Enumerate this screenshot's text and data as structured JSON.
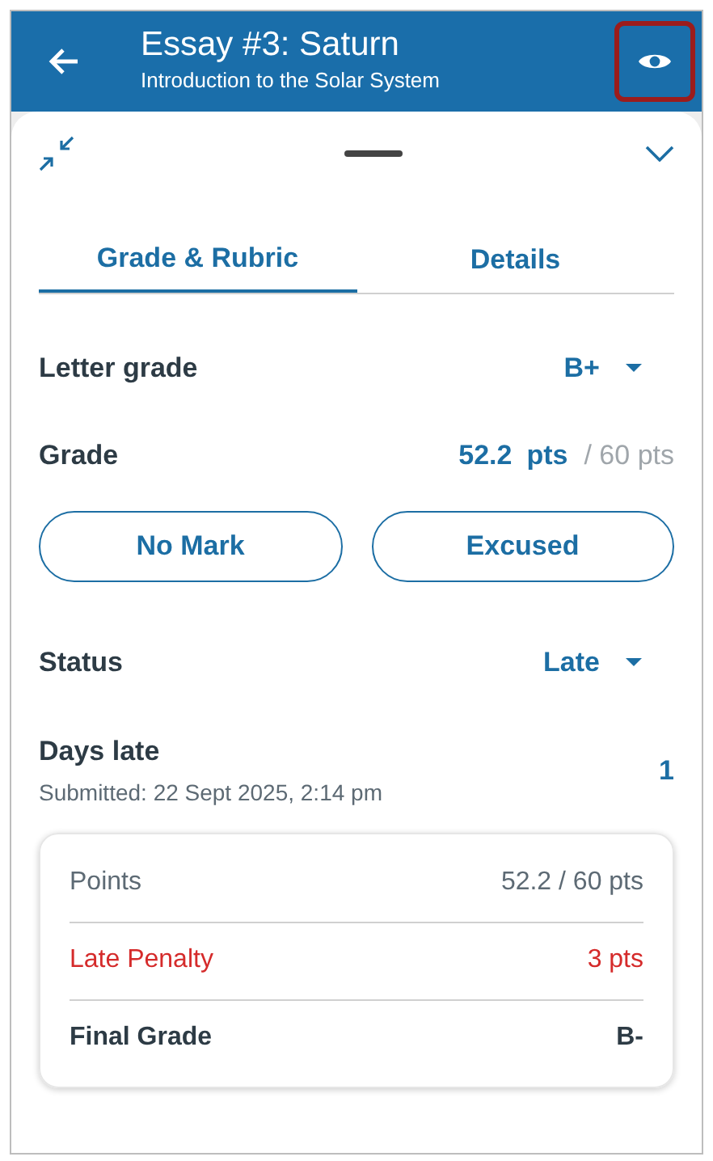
{
  "header": {
    "title": "Essay #3: Saturn",
    "subtitle": "Introduction to the Solar System",
    "preview_button": {
      "highlighted": true
    }
  },
  "tabs": [
    {
      "label": "Grade & Rubric",
      "selected": true
    },
    {
      "label": "Details",
      "selected": false
    }
  ],
  "letter_grade": {
    "label": "Letter grade",
    "value": "B+"
  },
  "grade": {
    "label": "Grade",
    "value": "52.2",
    "unit": "pts",
    "total": "/ 60 pts"
  },
  "grade_buttons": [
    "No Mark",
    "Excused"
  ],
  "status": {
    "label": "Status",
    "value": "Late"
  },
  "days_late": {
    "label": "Days late",
    "submitted": "Submitted: 22 Sept 2025, 2:14 pm",
    "value": "1"
  },
  "summary": [
    {
      "kind": "normal",
      "label": "Points",
      "value": "52.2 / 60 pts"
    },
    {
      "kind": "penalty",
      "label": "Late Penalty",
      "value": "3 pts"
    },
    {
      "kind": "total",
      "label": "Final Grade",
      "value": "B-"
    }
  ]
}
